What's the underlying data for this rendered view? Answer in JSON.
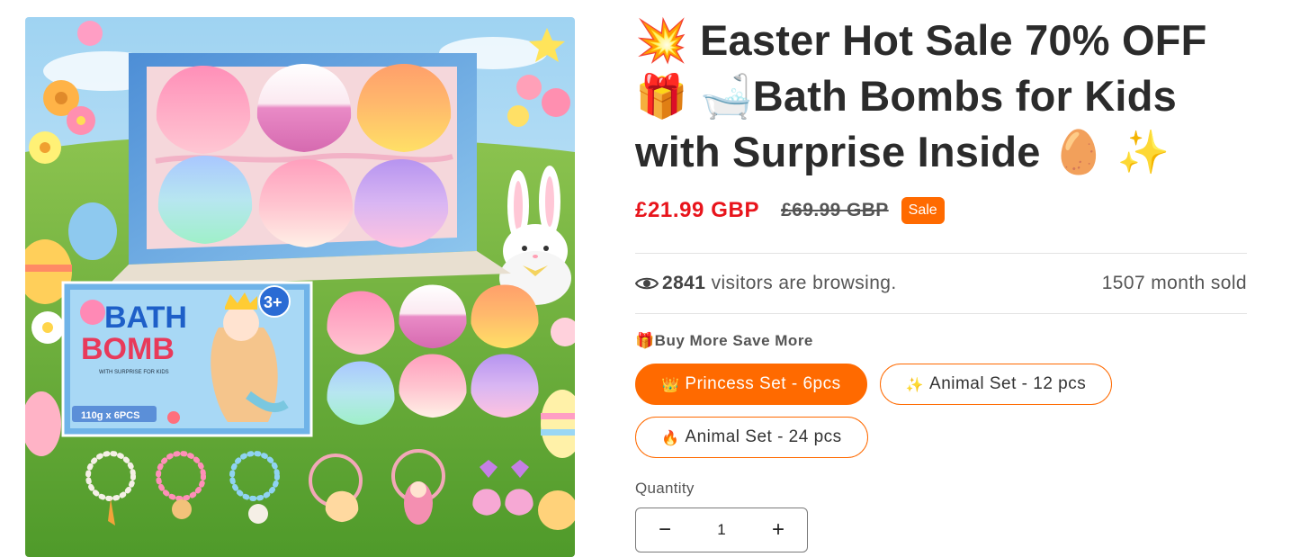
{
  "product": {
    "title_parts": {
      "e1": "💥",
      "line1": "Easter Hot Sale 70% OFF",
      "e2": "🎁",
      "e3": "🛁",
      "line2": "Bath Bombs for Kids",
      "line3": "with Surprise Inside",
      "e4": "🥚",
      "e5": "✨"
    },
    "price": "£21.99 GBP",
    "compare_price": "£69.99 GBP",
    "sale_badge": "Sale"
  },
  "stats": {
    "visitors_count": "2841",
    "visitors_text": " visitors are browsing.",
    "sold_text": "1507 month sold"
  },
  "promo": {
    "icon": "🎁",
    "label": "Buy More Save More"
  },
  "variants": [
    {
      "icon": "👑",
      "label": "Princess Set - 6pcs",
      "selected": true
    },
    {
      "icon": "✨",
      "label": "Animal Set - 12 pcs",
      "selected": false
    },
    {
      "icon": "🔥",
      "label": "Animal Set - 24 pcs",
      "selected": false
    }
  ],
  "quantity": {
    "label": "Quantity",
    "value": "1",
    "minus": "−",
    "plus": "+"
  },
  "image": {
    "box_text_1": "BATH",
    "box_text_2": "BOMB",
    "box_sub": "WITH SURPRISE FOR KIDS",
    "box_weight": "110g x 6PCS",
    "age_badge": "3+"
  },
  "colors": {
    "accent": "#ff6a00",
    "price": "#e8141b",
    "grass": "#6fae3c",
    "sky": "#bfe3f5"
  }
}
